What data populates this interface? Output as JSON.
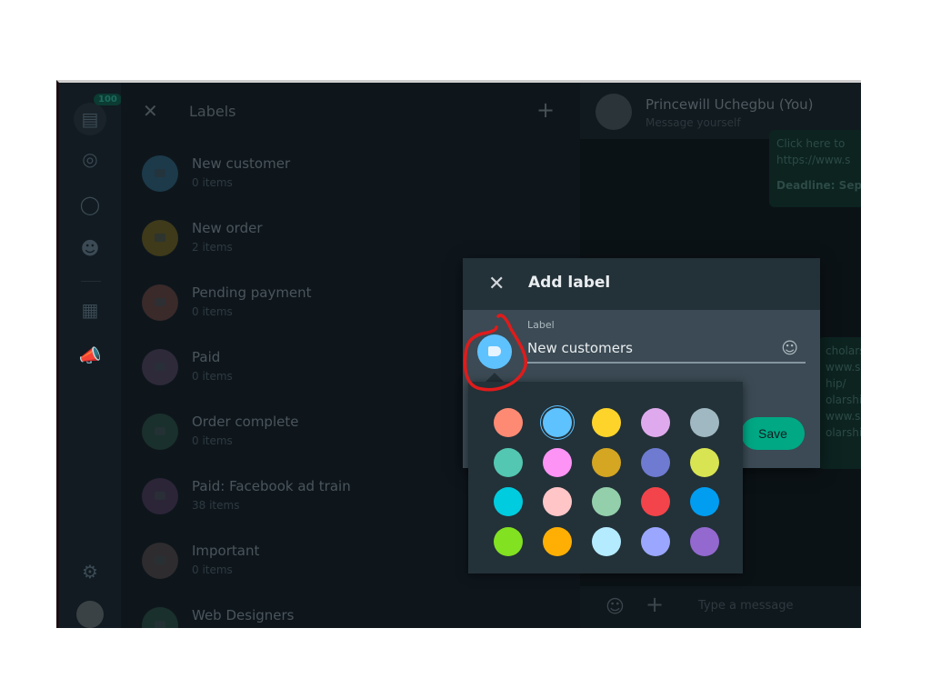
{
  "nav": {
    "badge": "100"
  },
  "labels_panel": {
    "title": "Labels",
    "items": [
      {
        "name": "New customer",
        "count": "0 items",
        "color": "#1c3a4a"
      },
      {
        "name": "New order",
        "count": "2 items",
        "color": "#3e3a1a"
      },
      {
        "name": "Pending payment",
        "count": "0 items",
        "color": "#3a2a2a"
      },
      {
        "name": "Paid",
        "count": "0 items",
        "color": "#2e2a3a"
      },
      {
        "name": "Order complete",
        "count": "0 items",
        "color": "#1a302c"
      },
      {
        "name": "Paid: Facebook ad train",
        "count": "38 items",
        "color": "#2c2538"
      },
      {
        "name": "Important",
        "count": "0 items",
        "color": "#2e2c2e"
      },
      {
        "name": "Web Designers",
        "count": "",
        "color": "#1a302c"
      }
    ]
  },
  "chat": {
    "contact_name": "Princewill Uchegbu (You)",
    "contact_sub": "Message yourself",
    "bubble1": [
      "Click here to",
      "https://www.s",
      "",
      "Deadline: Sept"
    ],
    "bubble2": [
      "cholarsh",
      "www.sch",
      "hip/",
      "olarship",
      "",
      "www.sc",
      "olarship"
    ],
    "input_placeholder": "Type a message"
  },
  "dialog": {
    "title": "Add label",
    "field_label": "Label",
    "field_value": "New customers",
    "save_label": "Save",
    "selected_color": "#5ec2ff"
  },
  "color_picker": {
    "colors": [
      "#ff8a73",
      "#5ec2ff",
      "#ffd42a",
      "#dfaaed",
      "#9fb8c1",
      "#53c7b1",
      "#fc93f5",
      "#d4a621",
      "#6e7bd0",
      "#d8e452",
      "#00ccdf",
      "#ffc5c7",
      "#93cfab",
      "#f2444a",
      "#009df0",
      "#82e121",
      "#ffaf04",
      "#b5ebff",
      "#9ba6fe",
      "#9368cf"
    ],
    "selected_index": 1
  },
  "annotation": {
    "color": "#e01b1b"
  }
}
